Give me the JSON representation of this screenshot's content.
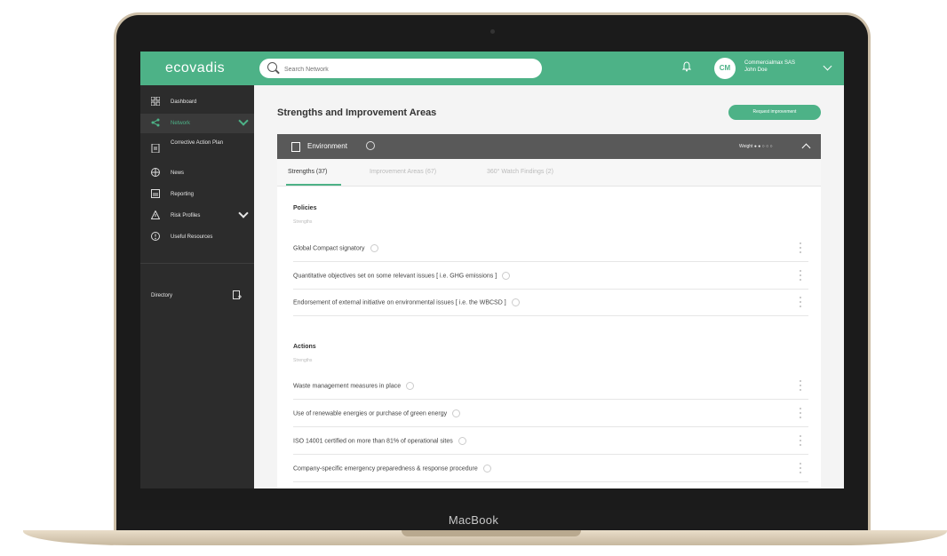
{
  "device": {
    "brand": "MacBook"
  },
  "app": {
    "logo": "ecovadis"
  },
  "header": {
    "search_placeholder": "Search Network",
    "avatar_initials": "CM",
    "user_name": "Commercialmax SAS",
    "user_sub": "John Doe"
  },
  "sidebar": {
    "items": [
      {
        "label": "Dashboard"
      },
      {
        "label": "Network"
      },
      {
        "label": "Corrective Action Plan"
      },
      {
        "label": "News"
      },
      {
        "label": "Reporting"
      },
      {
        "label": "Risk Profiles"
      },
      {
        "label": "Useful Resources"
      }
    ],
    "directory_label": "Directory"
  },
  "main": {
    "title": "Strengths and Improvement Areas",
    "request_button": "Request improvement",
    "section": {
      "label": "Environment",
      "weight": "Weight ● ● ○ ○ ○"
    },
    "tabs": [
      {
        "label": "Strengths (37)"
      },
      {
        "label": "Improvement Areas (67)"
      },
      {
        "label": "360° Watch Findings (2)"
      }
    ],
    "groups": [
      {
        "title": "Policies",
        "subtitle": "Strengths",
        "rows": [
          "Global Compact signatory",
          "Quantitative objectives set on some relevant issues [ i.e. GHG emissions ]",
          "Endorsement of external initiative on environmental issues [ i.e. the WBCSD ]"
        ]
      },
      {
        "title": "Actions",
        "subtitle": "Strengths",
        "rows": [
          "Waste management measures in place",
          "Use of renewable energies or purchase of green energy",
          "ISO 14001 certified on more than 81% of operational sites",
          "Company-specific emergency preparedness & response procedure"
        ]
      }
    ]
  },
  "colors": {
    "accent": "#4db287",
    "sidebar": "#2c2c2c",
    "section_bar": "#595959"
  }
}
